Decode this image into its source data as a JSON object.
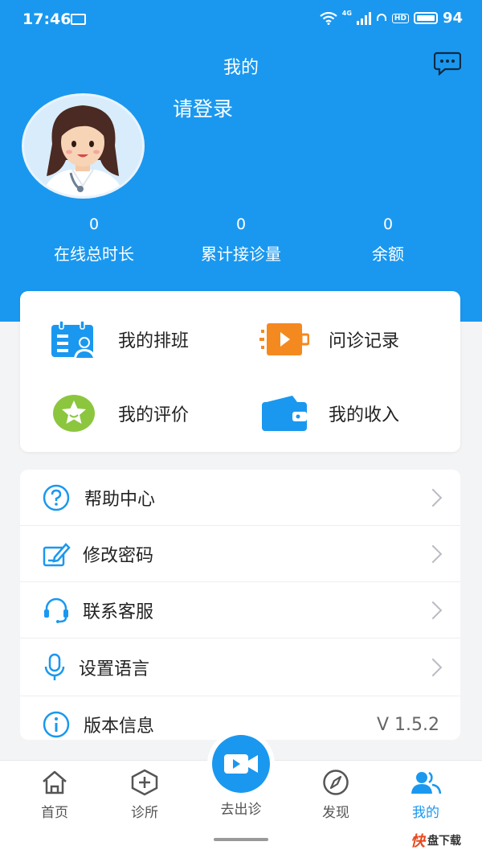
{
  "status_bar": {
    "time": "17:46",
    "network": "4G",
    "hd": "HD",
    "battery": "94"
  },
  "header": {
    "title": "我的",
    "login_prompt": "请登录"
  },
  "stats": [
    {
      "value": "0",
      "label": "在线总时长"
    },
    {
      "value": "0",
      "label": "累计接诊量"
    },
    {
      "value": "0",
      "label": "余额"
    }
  ],
  "quick_actions": [
    {
      "label": "我的排班",
      "icon": "schedule-icon"
    },
    {
      "label": "问诊记录",
      "icon": "video-record-icon"
    },
    {
      "label": "我的评价",
      "icon": "star-rating-icon"
    },
    {
      "label": "我的收入",
      "icon": "wallet-icon"
    }
  ],
  "menu": [
    {
      "label": "帮助中心",
      "icon": "help-icon"
    },
    {
      "label": "修改密码",
      "icon": "edit-password-icon"
    },
    {
      "label": "联系客服",
      "icon": "headset-icon"
    },
    {
      "label": "设置语言",
      "icon": "microphone-icon"
    },
    {
      "label": "版本信息",
      "icon": "info-icon",
      "value": "V 1.5.2"
    }
  ],
  "bottom_nav": {
    "home": "首页",
    "clinic": "诊所",
    "consult": "去出诊",
    "discover": "发现",
    "mine": "我的"
  },
  "watermark": {
    "brand": "快",
    "text": "盘下载"
  },
  "colors": {
    "primary": "#1a98ef",
    "orange": "#f48a1f",
    "green": "#8cc63f"
  }
}
